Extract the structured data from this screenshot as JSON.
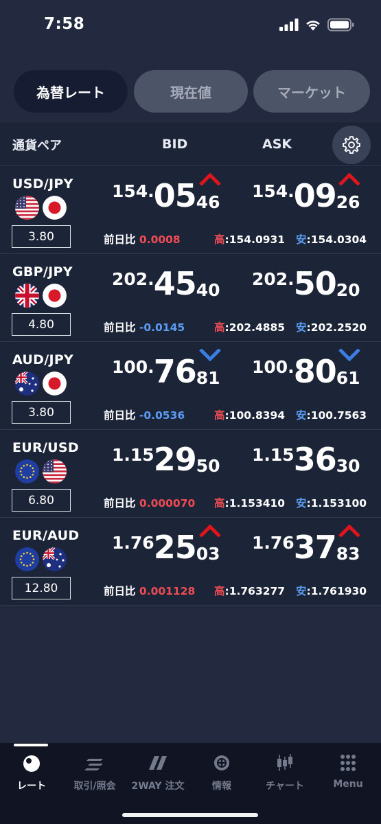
{
  "status": {
    "time": "7:58"
  },
  "tabs": [
    {
      "label": "為替レート",
      "active": true
    },
    {
      "label": "現在値",
      "active": false
    },
    {
      "label": "マーケット",
      "active": false
    }
  ],
  "header": {
    "pair": "通貨ペア",
    "bid": "BID",
    "ask": "ASK"
  },
  "labels": {
    "change": "前日比 ",
    "high": "高",
    "low": "安"
  },
  "colors": {
    "up": "#ee4b53",
    "down": "#5b9cf2",
    "arrow_up": "#e0141c",
    "arrow_down": "#3b7de0"
  },
  "rows": [
    {
      "pair": "USD/JPY",
      "flags": [
        "us-flag-icon",
        "jp-flag-icon"
      ],
      "spread": "3.80",
      "direction": "up",
      "bid": {
        "head": "154.",
        "big": "05",
        "small": "46"
      },
      "ask": {
        "head": "154.",
        "big": "09",
        "small": "26"
      },
      "change": "0.0008",
      "high": ":154.0931",
      "low": ":154.0304"
    },
    {
      "pair": "GBP/JPY",
      "flags": [
        "uk-flag-icon",
        "jp-flag-icon"
      ],
      "spread": "4.80",
      "direction": "none",
      "bid": {
        "head": "202.",
        "big": "45",
        "small": "40"
      },
      "ask": {
        "head": "202.",
        "big": "50",
        "small": "20"
      },
      "change": "-0.0145",
      "high": ":202.4885",
      "low": ":202.2520"
    },
    {
      "pair": "AUD/JPY",
      "flags": [
        "au-flag-icon",
        "jp-flag-icon"
      ],
      "spread": "3.80",
      "direction": "down",
      "bid": {
        "head": "100.",
        "big": "76",
        "small": "81"
      },
      "ask": {
        "head": "100.",
        "big": "80",
        "small": "61"
      },
      "change": "-0.0536",
      "high": ":100.8394",
      "low": ":100.7563"
    },
    {
      "pair": "EUR/USD",
      "flags": [
        "eu-flag-icon",
        "us-flag-icon"
      ],
      "spread": "6.80",
      "direction": "none",
      "bid": {
        "head": "1.15",
        "big": "29",
        "small": "50"
      },
      "ask": {
        "head": "1.15",
        "big": "36",
        "small": "30"
      },
      "change": "0.000070",
      "high": ":1.153410",
      "low": ":1.153100"
    },
    {
      "pair": "EUR/AUD",
      "flags": [
        "eu-flag-icon",
        "au-flag-icon"
      ],
      "spread": "12.80",
      "direction": "up",
      "bid": {
        "head": "1.76",
        "big": "25",
        "small": "03"
      },
      "ask": {
        "head": "1.76",
        "big": "37",
        "small": "83"
      },
      "change": "0.001128",
      "high": ":1.763277",
      "low": ":1.761930"
    }
  ],
  "tabbar": [
    {
      "label": "レート",
      "icon": "rate-icon",
      "active": true
    },
    {
      "label": "取引/照会",
      "icon": "trade-icon",
      "active": false
    },
    {
      "label": "2WAY 注文",
      "icon": "twoway-icon",
      "active": false
    },
    {
      "label": "情報",
      "icon": "info-icon",
      "active": false
    },
    {
      "label": "チャート",
      "icon": "chart-icon",
      "active": false
    },
    {
      "label": "Menu",
      "icon": "menu-grid-icon",
      "active": false
    }
  ]
}
